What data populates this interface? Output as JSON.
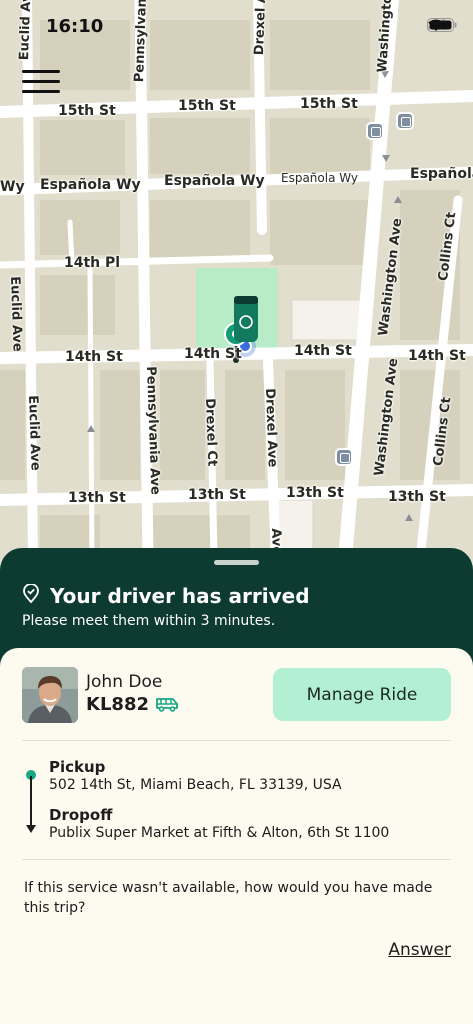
{
  "status_bar": {
    "time": "16:10"
  },
  "map": {
    "streets": {
      "h1": "15th St",
      "h2": "15th St",
      "h3": "Española Wy",
      "h4": "Española Wy",
      "h5": "Española Wy",
      "h6": "Española",
      "h7": "14th Pl",
      "h8": "14th St",
      "h9": "14th St",
      "h10": "14th St",
      "h11": "14th St",
      "h12": "13th St",
      "h13": "13th St",
      "h14": "13th St",
      "h15": "13th St",
      "h16": "Wy",
      "v1": "Euclid Ave",
      "v2": "Pennsylvania Ave",
      "v3": "Drexel Ave",
      "v4": "Washington Ave",
      "v5": "Collins Ct",
      "v6": "Euclid Ave",
      "v7": "Euclid Ave",
      "v8": "Pennsylvania Ave",
      "v9": "Drexel Ct",
      "v10": "Drexel Ave",
      "v11": "Washington Ave",
      "v12": "Collins Ct",
      "v13": "Washington Ave",
      "v14": "Drexel Ave",
      "v15": "Ave"
    }
  },
  "trip_status": {
    "title": "Your driver has arrived",
    "subtitle": "Please meet them within 3 minutes."
  },
  "driver": {
    "name": "John Doe",
    "plate": "KL882",
    "manage_label": "Manage Ride"
  },
  "route": {
    "pickup_label": "Pickup",
    "pickup_address": "502 14th St, Miami Beach, FL 33139, USA",
    "dropoff_label": "Dropoff",
    "dropoff_address": "Publix Super Market at Fifth & Alton, 6th St 1100"
  },
  "survey": {
    "question": "If this service wasn't available, how would you have made this trip?",
    "answer_label": "Answer"
  },
  "colors": {
    "sheet_dark": "#0d3b31",
    "sheet_light": "#fdfaf0",
    "accent": "#b3f0d3",
    "marker": "#15a882"
  }
}
